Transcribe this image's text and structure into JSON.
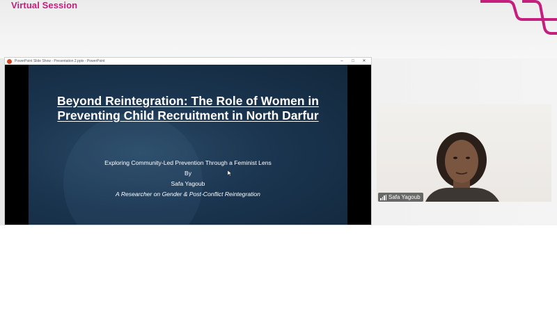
{
  "header": {
    "session_label": "Virtual Session"
  },
  "colors": {
    "brand": "#c41e7f",
    "slide_bg": "#1b3550"
  },
  "presentation_window": {
    "title": "PowerPoint Slide Show - Presentation 2.pptx - PowerPoint",
    "controls": [
      "–",
      "□",
      "✕"
    ]
  },
  "slide": {
    "title": "Beyond Reintegration: The Role of Women in Preventing Child Recruitment in North Darfur",
    "subtitle": "Exploring Community-Led Prevention Through a Feminist Lens",
    "by": "By",
    "author": "Safa Yagoub",
    "author_role": "A Researcher on Gender & Post-Conflict Reintegration"
  },
  "webcam": {
    "participant_name": "Safa Yagoub",
    "signal_icon": "signal-bars-icon"
  }
}
